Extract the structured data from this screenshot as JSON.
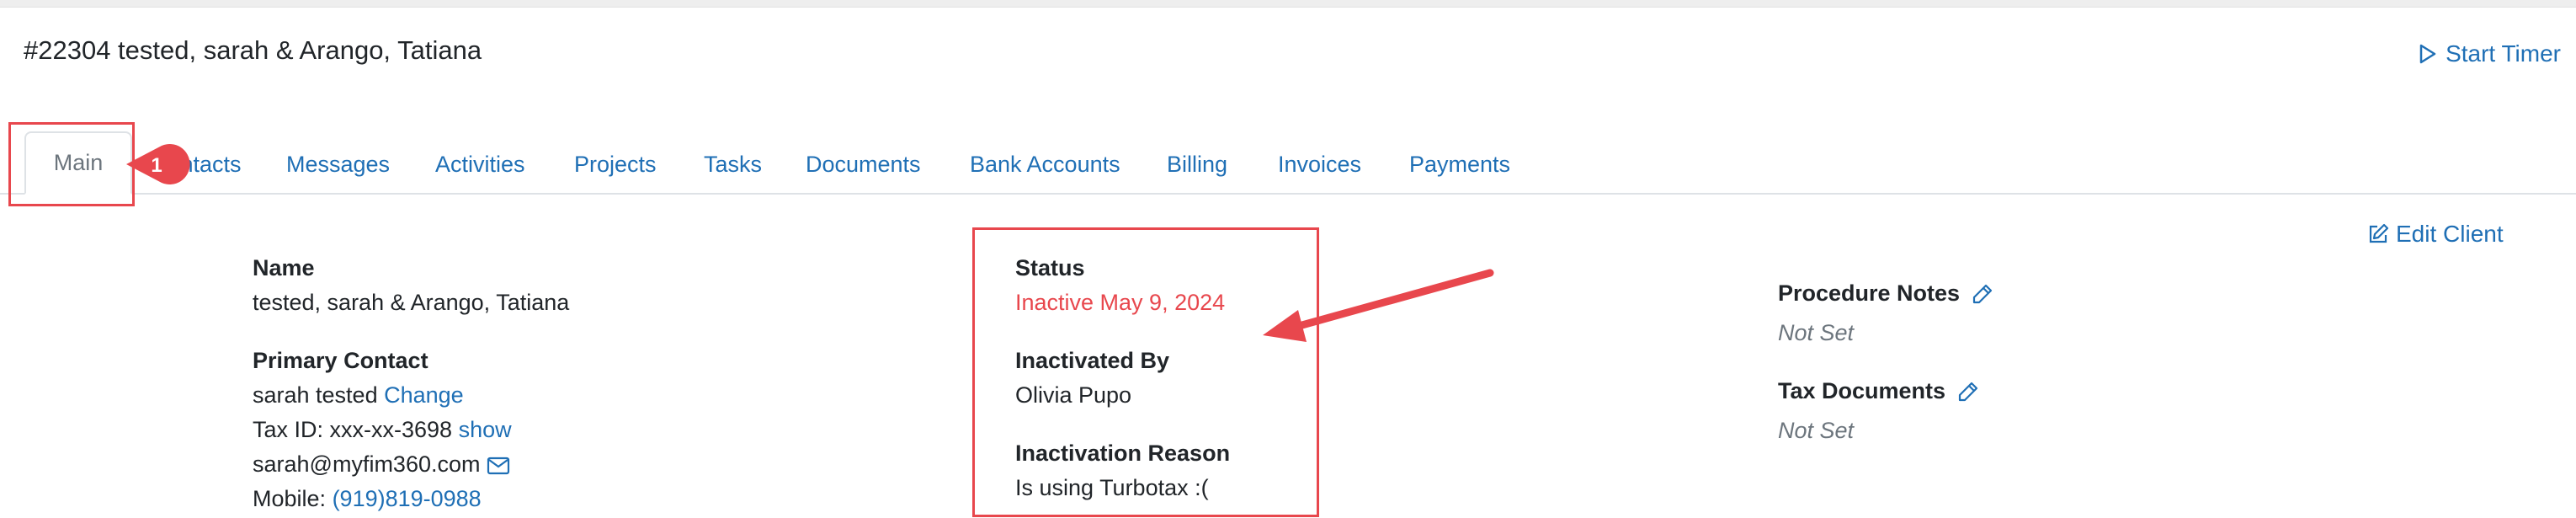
{
  "header": {
    "title": "#22304 tested, sarah & Arango, Tatiana",
    "start_timer": "Start Timer"
  },
  "tabs": [
    {
      "label": "Main",
      "active": true
    },
    {
      "label": "Contacts"
    },
    {
      "label": "Messages"
    },
    {
      "label": "Activities"
    },
    {
      "label": "Projects"
    },
    {
      "label": "Tasks"
    },
    {
      "label": "Documents"
    },
    {
      "label": "Bank Accounts"
    },
    {
      "label": "Billing"
    },
    {
      "label": "Invoices"
    },
    {
      "label": "Payments"
    }
  ],
  "annotation": {
    "step_number": "1"
  },
  "left": {
    "name_label": "Name",
    "name_value": "tested, sarah & Arango, Tatiana",
    "primary_contact_label": "Primary Contact",
    "primary_contact_name": "sarah tested",
    "change_link": "Change",
    "tax_id": "Tax ID: xxx-xx-3698",
    "show_link": "show",
    "email": "sarah@myfim360.com",
    "mobile_label": "Mobile:",
    "mobile_value": "(919)819-0988"
  },
  "middle": {
    "status_label": "Status",
    "status_value": "Inactive May 9, 2024",
    "inactivated_by_label": "Inactivated By",
    "inactivated_by_value": "Olivia Pupo",
    "reason_label": "Inactivation Reason",
    "reason_value": "Is using Turbotax :("
  },
  "right": {
    "edit_client": "Edit Client",
    "procedure_notes_label": "Procedure Notes",
    "procedure_notes_value": "Not Set",
    "tax_documents_label": "Tax Documents",
    "tax_documents_value": "Not Set"
  },
  "colors": {
    "link": "#1f6fb5",
    "annotation_red": "#e8474d",
    "inactive_red": "#e8474d"
  }
}
